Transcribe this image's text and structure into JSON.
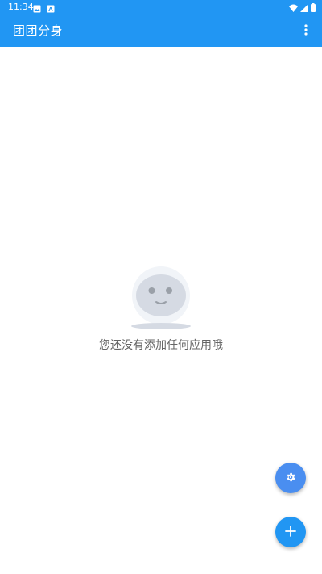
{
  "status_bar": {
    "time": "11:34",
    "left_icons": [
      "image-icon",
      "notification-icon"
    ],
    "right_icons": [
      "wifi-icon",
      "signal-icon",
      "battery-icon"
    ]
  },
  "toolbar": {
    "title": "团团分身",
    "overflow_icon": "more-vert-icon"
  },
  "empty_state": {
    "illustration": "empty-face-icon",
    "message": "您还没有添加任何应用哦"
  },
  "fabs": {
    "settings_icon": "gear-icon",
    "add_icon": "add-icon"
  },
  "colors": {
    "primary": "#2196f3",
    "settings_fab": "#4a8ef0",
    "text_secondary": "#666666"
  }
}
